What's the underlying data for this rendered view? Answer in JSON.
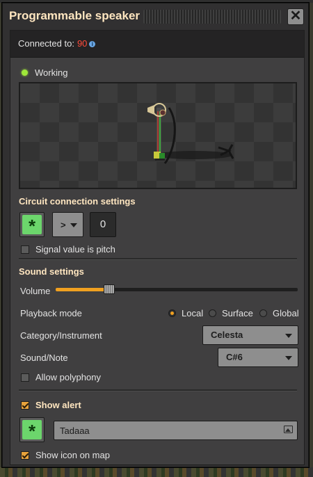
{
  "window": {
    "title": "Programmable speaker",
    "close_icon": "close-icon"
  },
  "connection": {
    "label": "Connected to:",
    "value": "90",
    "info_icon": "info-icon"
  },
  "status": {
    "text": "Working",
    "color": "#9fe83a"
  },
  "circuit": {
    "title": "Circuit connection settings",
    "signal_icon": "asterisk-signal-icon",
    "comparator": ">",
    "constant": "0",
    "pitch_checkbox_label": "Signal value is pitch",
    "pitch_checked": false
  },
  "sound": {
    "title": "Sound settings",
    "volume_label": "Volume",
    "volume_fraction": 0.22,
    "playback_label": "Playback mode",
    "playback_options": [
      "Local",
      "Surface",
      "Global"
    ],
    "playback_selected": "Local",
    "category_label": "Category/Instrument",
    "category_value": "Celesta",
    "note_label": "Sound/Note",
    "note_value": "C#6",
    "polyphony_label": "Allow polyphony",
    "polyphony_checked": false
  },
  "alert": {
    "show_alert_label": "Show alert",
    "show_alert_checked": true,
    "signal_icon": "asterisk-signal-icon",
    "message_value": "Tadaaa",
    "image_icon": "image-icon",
    "show_on_map_label": "Show icon on map",
    "show_on_map_checked": true
  },
  "colors": {
    "accent_orange": "#f0a020",
    "heading": "#ffe6c0",
    "error_red": "#ff4a3a",
    "signal_green": "#6cd66c"
  }
}
